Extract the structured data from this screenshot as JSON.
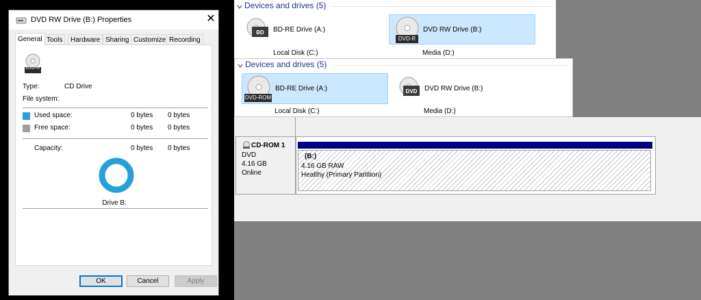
{
  "dialog": {
    "title": "DVD RW Drive (B:) Properties",
    "close_glyph": "✕",
    "tabs": [
      "General",
      "Tools",
      "Hardware",
      "Sharing",
      "Customize",
      "Recording"
    ],
    "active_tab": "General",
    "drive_icon_label": "DVD+R",
    "type_label": "Type:",
    "type_value": "CD Drive",
    "file_system_label": "File system:",
    "used_label": "Used space:",
    "used_bytes": "0 bytes",
    "used_size": "0 bytes",
    "free_label": "Free space:",
    "free_bytes": "0 bytes",
    "free_size": "0 bytes",
    "capacity_label": "Capacity:",
    "capacity_bytes": "0 bytes",
    "capacity_size": "0 bytes",
    "drive_caption": "Drive B:",
    "ok": "OK",
    "cancel": "Cancel",
    "apply": "Apply",
    "used_color": "#26a0da",
    "free_color": "#a0a0a0"
  },
  "explorer_top": {
    "group_header": "Devices and drives (5)",
    "drive1_name": "BD-RE Drive (A:)",
    "drive1_badge": "BD",
    "drive2_name": "DVD RW Drive (B:)",
    "drive2_badge": "DVD-R",
    "drive3_name": "Local Disk (C:)",
    "drive4_name": "Media (D:)"
  },
  "explorer_bottom": {
    "group_header": "Devices and drives (5)",
    "drive1_name": "BD-RE Drive (A:)",
    "drive1_badge": "DVD-ROM",
    "drive2_name": "DVD RW Drive (B:)",
    "drive2_badge": "DVD",
    "drive3_name": "Local Disk (C:)",
    "drive4_name": "Media (D:)"
  },
  "disk_management": {
    "disk_name": "CD-ROM 1",
    "disk_type": "DVD",
    "disk_size": "4.16 GB",
    "disk_status": "Online",
    "partition_letter": "(B:)",
    "partition_size": "4.16 GB RAW",
    "partition_status": "Healthy (Primary Partition)",
    "partition_bar_color": "#000080"
  },
  "icons": {
    "disc": "optical-disc-icon",
    "drive": "drive-icon",
    "chevron": "chevron-down-icon",
    "close": "close-icon"
  }
}
